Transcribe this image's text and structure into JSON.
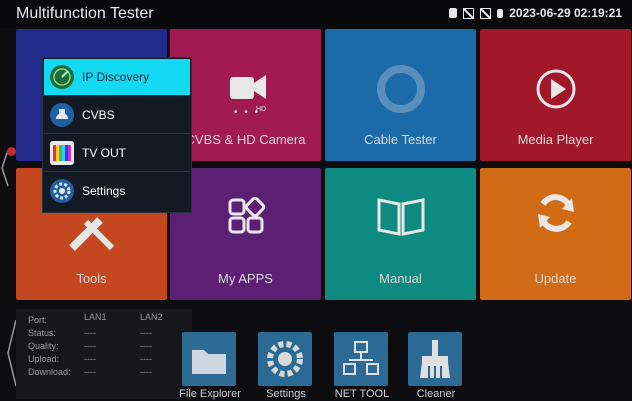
{
  "statusbar": {
    "title": "Multifunction Tester",
    "datetime": "2023-06-29 02:19:21"
  },
  "tiles": [
    {
      "label": "",
      "color": "#222a8a"
    },
    {
      "label": "CVBS & HD Camera",
      "color": "#a11a52"
    },
    {
      "label": "Cable Tester",
      "color": "#1d6aa8"
    },
    {
      "label": "Media Player",
      "color": "#a0182a"
    },
    {
      "label": "Tools",
      "color": "#c5471f"
    },
    {
      "label": "My APPS",
      "color": "#5b1f74"
    },
    {
      "label": "Manual",
      "color": "#0f8a80"
    },
    {
      "label": "Update",
      "color": "#d26b16"
    }
  ],
  "menu": {
    "items": [
      {
        "label": "IP Discovery",
        "icon": "radar-icon"
      },
      {
        "label": "CVBS",
        "icon": "dome-camera-icon"
      },
      {
        "label": "TV OUT",
        "icon": "color-bars-icon"
      },
      {
        "label": "Settings",
        "icon": "gear-icon"
      }
    ]
  },
  "network_panel": {
    "labels": [
      "Port:",
      "Status:",
      "Quality:",
      "Upload:",
      "Download:"
    ],
    "lan1": {
      "name": "LAN1",
      "values": [
        "----",
        "----",
        "----",
        "----"
      ]
    },
    "lan2": {
      "name": "LAN2",
      "values": [
        "----",
        "----",
        "----",
        "----"
      ]
    }
  },
  "dock": [
    {
      "label": "File Explorer",
      "icon": "folder-icon"
    },
    {
      "label": "Settings",
      "icon": "gear-icon"
    },
    {
      "label": "NET TOOL",
      "icon": "network-icon"
    },
    {
      "label": "Cleaner",
      "icon": "broom-icon"
    }
  ]
}
